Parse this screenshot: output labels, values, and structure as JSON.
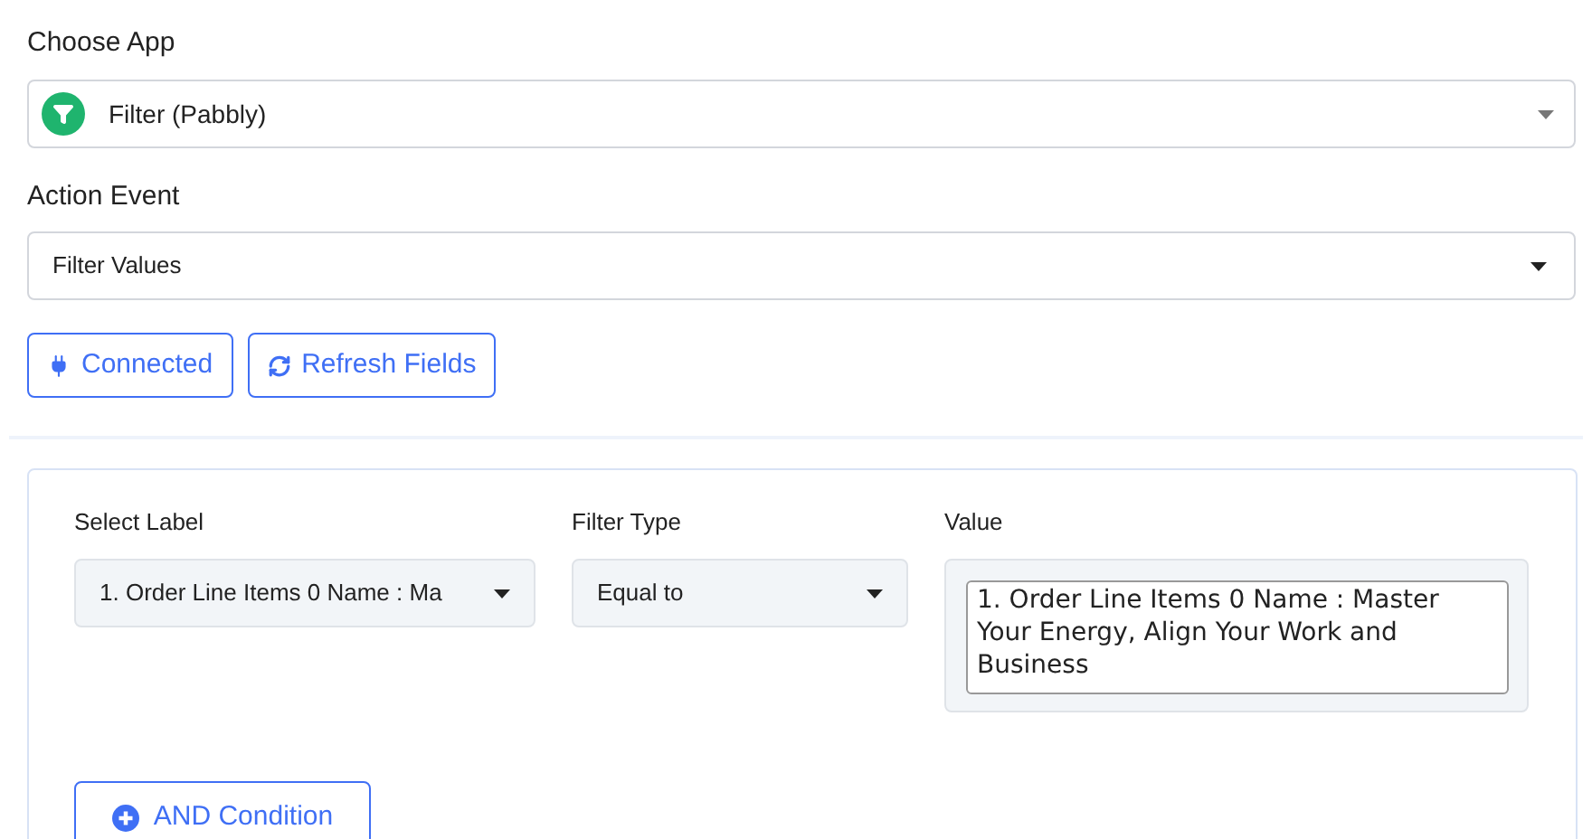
{
  "choose_app": {
    "label": "Choose App",
    "value": "Filter (Pabbly)"
  },
  "action_event": {
    "label": "Action Event",
    "value": "Filter Values"
  },
  "buttons": [
    {
      "label": "Connected",
      "kind": "connected"
    },
    {
      "label": "Refresh Fields",
      "kind": "refresh"
    }
  ],
  "condition": {
    "columns": [
      {
        "label": "Select Label",
        "kind": "select",
        "value": "1. Order Line Items 0 Name : Ma"
      },
      {
        "label": "Filter Type",
        "kind": "select",
        "value": "Equal to"
      },
      {
        "label": "Value",
        "kind": "text",
        "value": "1. Order Line Items 0 Name : Master Your Energy, Align Your Work and Business"
      }
    ],
    "and_button": "AND Condition"
  }
}
